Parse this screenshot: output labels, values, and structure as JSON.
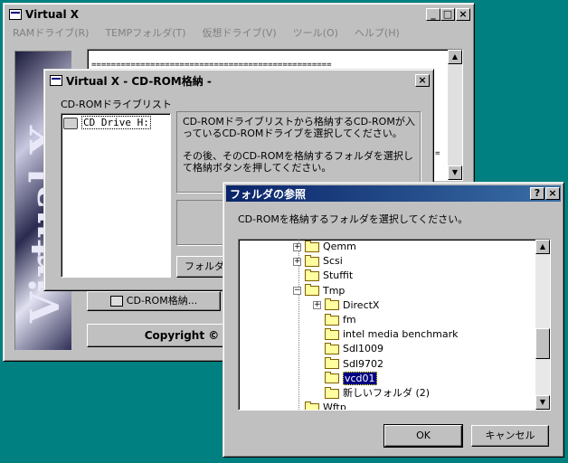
{
  "main_window": {
    "title": "Virtual X",
    "menu": [
      "RAMドライブ(R)",
      "TEMPフォルダ(T)",
      "仮想ドライブ(V)",
      "ツール(O)",
      "ヘルプ(H)"
    ],
    "log_line": "=================================================",
    "log_line2": "=",
    "banner_text": "Virtual X",
    "cdrom_button": "CD-ROM格納...",
    "copyright": "Copyright ©"
  },
  "cdrom_dialog": {
    "title": "Virtual X - CD-ROM格納 -",
    "list_label": "CD-ROMドライブリスト",
    "drives": [
      "CD Drive H:"
    ],
    "instruction1": "CD-ROMドライブリストから格納するCD-ROMが入っているCD-ROMドライブを選択してください。",
    "instruction2": "その後、そのCD-ROMを格納するフォルダを選択して格納ボタンを押してください。",
    "folder_button": "フォルダ"
  },
  "browse_dialog": {
    "title": "フォルダの参照",
    "help_btn": "?",
    "close_btn": "×",
    "prompt": "CD-ROMを格納するフォルダを選択してください。",
    "tree": [
      {
        "label": "Qemm",
        "expander": "+",
        "level": 0
      },
      {
        "label": "Scsi",
        "expander": "+",
        "level": 0
      },
      {
        "label": "Stuffit",
        "expander": "",
        "level": 0
      },
      {
        "label": "Tmp",
        "expander": "−",
        "level": 0
      },
      {
        "label": "DirectX",
        "expander": "+",
        "level": 1
      },
      {
        "label": "fm",
        "expander": "",
        "level": 1
      },
      {
        "label": "intel media benchmark",
        "expander": "",
        "level": 1
      },
      {
        "label": "Sdl1009",
        "expander": "",
        "level": 1
      },
      {
        "label": "Sdl9702",
        "expander": "",
        "level": 1
      },
      {
        "label": "vcd01",
        "expander": "",
        "level": 1,
        "selected": true
      },
      {
        "label": "新しいフォルダ (2)",
        "expander": "",
        "level": 1
      },
      {
        "label": "Wftp",
        "expander": "",
        "level": 0
      }
    ],
    "ok": "OK",
    "cancel": "キャンセル"
  },
  "colors": {
    "desktop": "#008080",
    "active_title": "#0a246a",
    "selection": "#000080"
  }
}
